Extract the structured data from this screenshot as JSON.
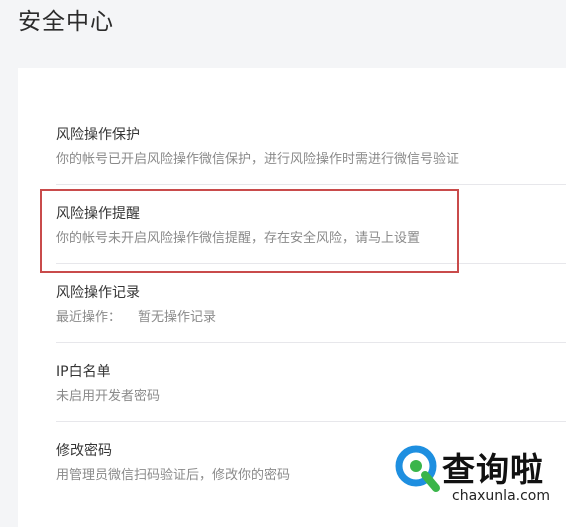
{
  "page": {
    "title": "安全中心"
  },
  "items": [
    {
      "title": "风险操作保护",
      "desc": "你的帐号已开启风险操作微信保护，进行风险操作时需进行微信号验证"
    },
    {
      "title": "风险操作提醒",
      "desc": "你的帐号未开启风险操作微信提醒，存在安全风险，请马上设置"
    },
    {
      "title": "风险操作记录",
      "desc_label": "最近操作：",
      "desc_value": "暂无操作记录"
    },
    {
      "title": "IP白名单",
      "desc": "未启用开发者密码"
    },
    {
      "title": "修改密码",
      "desc": "用管理员微信扫码验证后，修改你的密码"
    }
  ],
  "watermark": {
    "text": "查询啦",
    "domain": "chaxunla.com",
    "logo_icon": "magnifier-q-logo",
    "colors": {
      "blue": "#1e8fe0",
      "green": "#3ab54a"
    }
  },
  "colors": {
    "highlight_border": "#c94b4b",
    "background": "#f4f5f7",
    "panel": "#ffffff",
    "title_text": "#353535",
    "desc_text": "#8a8a8a"
  }
}
